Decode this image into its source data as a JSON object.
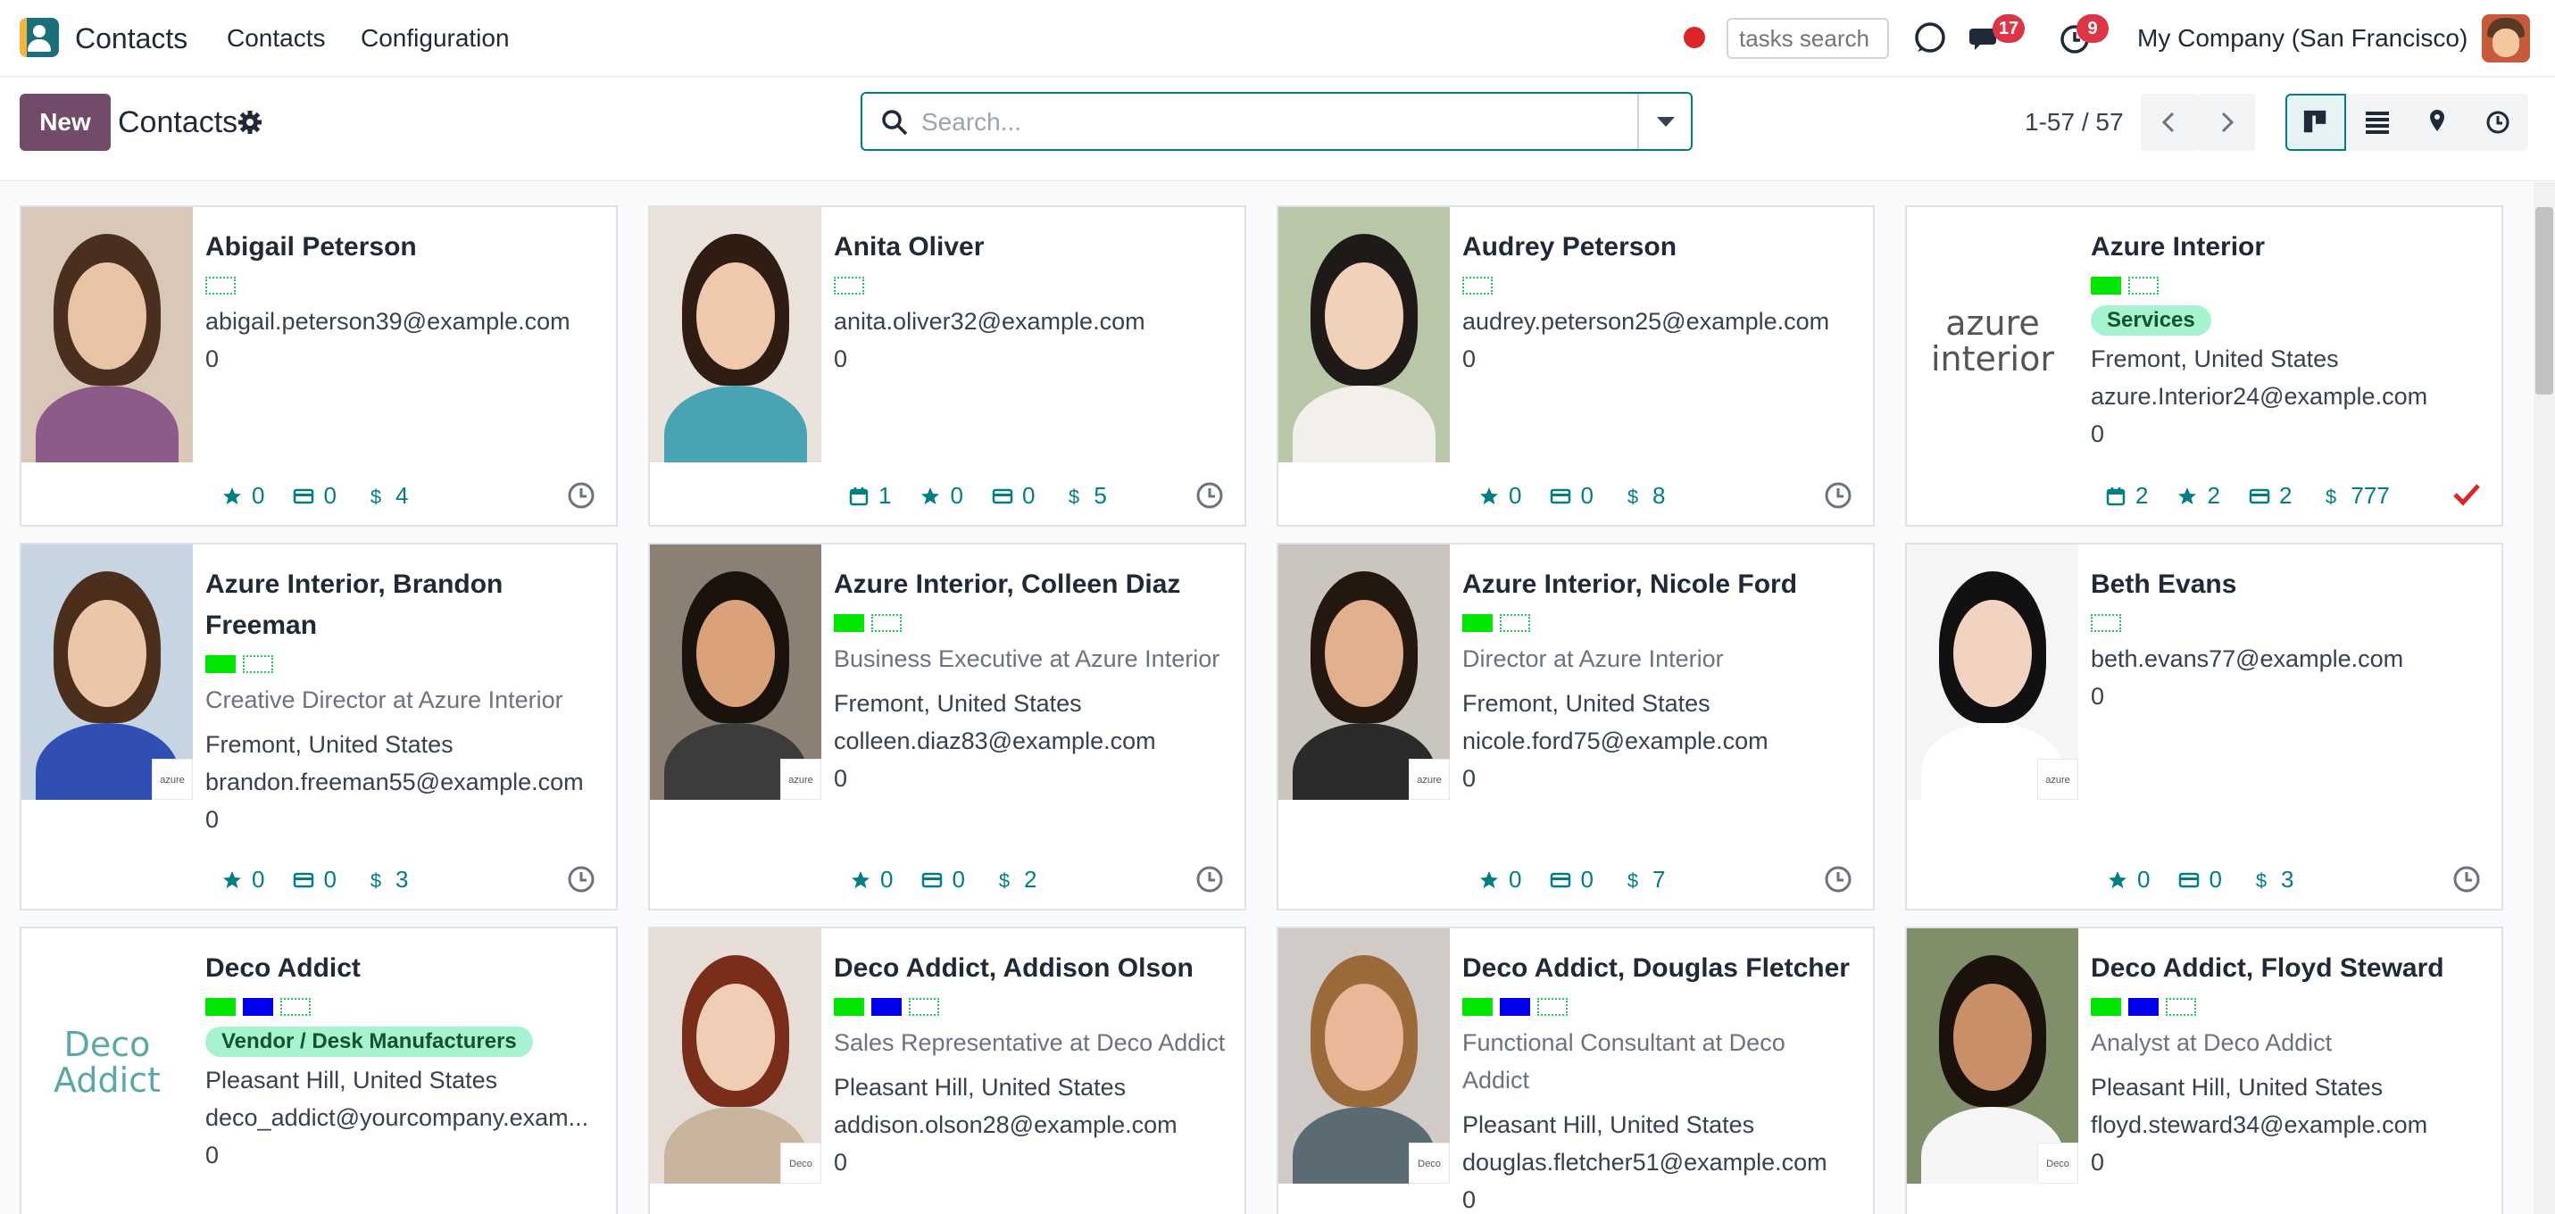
{
  "navbar": {
    "brand": "Contacts",
    "menu": [
      "Contacts",
      "Configuration"
    ],
    "tasks_search_placeholder": "tasks search",
    "messages_badge": "17",
    "activities_badge": "9",
    "company": "My Company (San Francisco)"
  },
  "control": {
    "new_label": "New",
    "title": "Contacts",
    "search_placeholder": "Search...",
    "pager": "1-57 / 57"
  },
  "colors": {
    "brand": "#714b67",
    "accent": "#017e84",
    "tag_green": "#00e600",
    "tag_blue": "#0000ee"
  },
  "cards": [
    {
      "name": "Abigail Peterson",
      "tags": [
        "empty"
      ],
      "lines": [
        {
          "t": "abigail.peterson39@example.com"
        },
        {
          "t": "0"
        }
      ],
      "stats": [
        [
          "star",
          "0"
        ],
        [
          "card",
          "0"
        ],
        [
          "dollar",
          "4"
        ]
      ]
    },
    {
      "name": "Anita Oliver",
      "tags": [
        "empty"
      ],
      "lines": [
        {
          "t": "anita.oliver32@example.com"
        },
        {
          "t": "0"
        }
      ],
      "stats": [
        [
          "calendar",
          "1"
        ],
        [
          "star",
          "0"
        ],
        [
          "card",
          "0"
        ],
        [
          "dollar",
          "5"
        ]
      ]
    },
    {
      "name": "Audrey Peterson",
      "tags": [
        "empty"
      ],
      "lines": [
        {
          "t": "audrey.peterson25@example.com"
        },
        {
          "t": "0"
        }
      ],
      "stats": [
        [
          "star",
          "0"
        ],
        [
          "card",
          "0"
        ],
        [
          "dollar",
          "8"
        ]
      ]
    },
    {
      "name": "Azure Interior",
      "tags": [
        "green",
        "empty"
      ],
      "pill": "Services",
      "lines": [
        {
          "t": "Fremont, United States"
        },
        {
          "t": "azure.Interior24@example.com"
        },
        {
          "t": "0"
        }
      ],
      "stats": [
        [
          "calendar",
          "2"
        ],
        [
          "star",
          "2"
        ],
        [
          "card",
          "2"
        ],
        [
          "dollar",
          "777"
        ]
      ],
      "logo_text": "azure interior"
    },
    {
      "name": "Azure Interior, Brandon",
      "name2": "Freeman",
      "tags": [
        "green",
        "empty"
      ],
      "lines": [
        {
          "t": "Creative Director at Azure Interior",
          "muted": true
        },
        {
          "t": "Fremont, United States"
        },
        {
          "t": "brandon.freeman55@example.com"
        },
        {
          "t": "0"
        }
      ],
      "stats": [
        [
          "star",
          "0"
        ],
        [
          "card",
          "0"
        ],
        [
          "dollar",
          "3"
        ]
      ]
    },
    {
      "name": "Azure Interior, Colleen Diaz",
      "tags": [
        "green",
        "empty"
      ],
      "lines": [
        {
          "t": "Business Executive at Azure Interior",
          "muted": true
        },
        {
          "t": "Fremont, United States"
        },
        {
          "t": "colleen.diaz83@example.com"
        },
        {
          "t": "0"
        }
      ],
      "stats": [
        [
          "star",
          "0"
        ],
        [
          "card",
          "0"
        ],
        [
          "dollar",
          "2"
        ]
      ]
    },
    {
      "name": "Azure Interior, Nicole Ford",
      "tags": [
        "green",
        "empty"
      ],
      "lines": [
        {
          "t": "Director at Azure Interior",
          "muted": true
        },
        {
          "t": "Fremont, United States"
        },
        {
          "t": "nicole.ford75@example.com"
        },
        {
          "t": "0"
        }
      ],
      "stats": [
        [
          "star",
          "0"
        ],
        [
          "card",
          "0"
        ],
        [
          "dollar",
          "7"
        ]
      ]
    },
    {
      "name": "Beth Evans",
      "tags": [
        "empty"
      ],
      "lines": [
        {
          "t": "beth.evans77@example.com"
        },
        {
          "t": "0"
        }
      ],
      "stats": [
        [
          "star",
          "0"
        ],
        [
          "card",
          "0"
        ],
        [
          "dollar",
          "3"
        ]
      ]
    },
    {
      "name": "Deco Addict",
      "tags": [
        "green",
        "blue",
        "empty"
      ],
      "pill": "Vendor / Desk Manufacturers",
      "lines": [
        {
          "t": "Pleasant Hill, United States"
        },
        {
          "t": "deco_addict@yourcompany.exam..."
        },
        {
          "t": "0"
        }
      ],
      "logo_text": "Deco Addict"
    },
    {
      "name": "Deco Addict, Addison Olson",
      "tags": [
        "green",
        "blue",
        "empty"
      ],
      "lines": [
        {
          "t": "Sales Representative at Deco Addict",
          "muted": true
        },
        {
          "t": "Pleasant Hill, United States"
        },
        {
          "t": "addison.olson28@example.com"
        },
        {
          "t": "0"
        }
      ]
    },
    {
      "name": "Deco Addict, Douglas Fletcher",
      "tags": [
        "green",
        "blue",
        "empty"
      ],
      "lines": [
        {
          "t": "Functional Consultant at Deco",
          "muted": true
        },
        {
          "t": "Addict",
          "muted": true
        },
        {
          "t": "Pleasant Hill, United States"
        },
        {
          "t": "douglas.fletcher51@example.com"
        },
        {
          "t": "0"
        }
      ]
    },
    {
      "name": "Deco Addict, Floyd Steward",
      "tags": [
        "green",
        "blue",
        "empty"
      ],
      "lines": [
        {
          "t": "Analyst at Deco Addict",
          "muted": true
        },
        {
          "t": "Pleasant Hill, United States"
        },
        {
          "t": "floyd.steward34@example.com"
        },
        {
          "t": "0"
        }
      ]
    }
  ]
}
